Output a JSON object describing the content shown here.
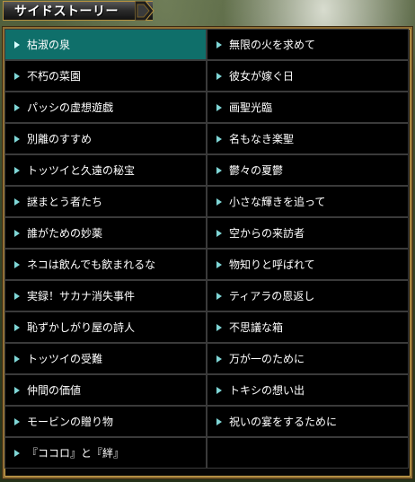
{
  "header": {
    "title": "サイドストーリー"
  },
  "colors": {
    "active_bg": "#0f6f6a",
    "frame_gold": "#c9a24d",
    "arrow": "#7fd6d6"
  },
  "icons": {
    "row_marker": "triangle-right-icon"
  },
  "stories": {
    "left": [
      {
        "label": "枯淑の泉",
        "active": true
      },
      {
        "label": "不朽の菜園"
      },
      {
        "label": "パッシの虚想遊戯"
      },
      {
        "label": "別離のすすめ"
      },
      {
        "label": "トッツイと久遠の秘宝"
      },
      {
        "label": "謎まとう者たち"
      },
      {
        "label": "誰がための妙薬"
      },
      {
        "label": "ネコは飲んでも飲まれるな"
      },
      {
        "label": "実録！サカナ消失事件"
      },
      {
        "label": "恥ずかしがり屋の詩人"
      },
      {
        "label": "トッツイの受難"
      },
      {
        "label": "仲間の価値"
      },
      {
        "label": "モービンの贈り物"
      },
      {
        "label": "『ココロ』と『絆』"
      }
    ],
    "right": [
      {
        "label": "無限の火を求めて"
      },
      {
        "label": "彼女が嫁ぐ日"
      },
      {
        "label": "画聖光臨"
      },
      {
        "label": "名もなき楽聖"
      },
      {
        "label": "鬱々の夏鬱"
      },
      {
        "label": "小さな輝きを追って"
      },
      {
        "label": "空からの来訪者"
      },
      {
        "label": "物知りと呼ばれて"
      },
      {
        "label": "ティアラの恩返し"
      },
      {
        "label": "不思議な箱"
      },
      {
        "label": "万が一のために"
      },
      {
        "label": "トキシの想い出"
      },
      {
        "label": "祝いの宴をするために"
      }
    ]
  }
}
